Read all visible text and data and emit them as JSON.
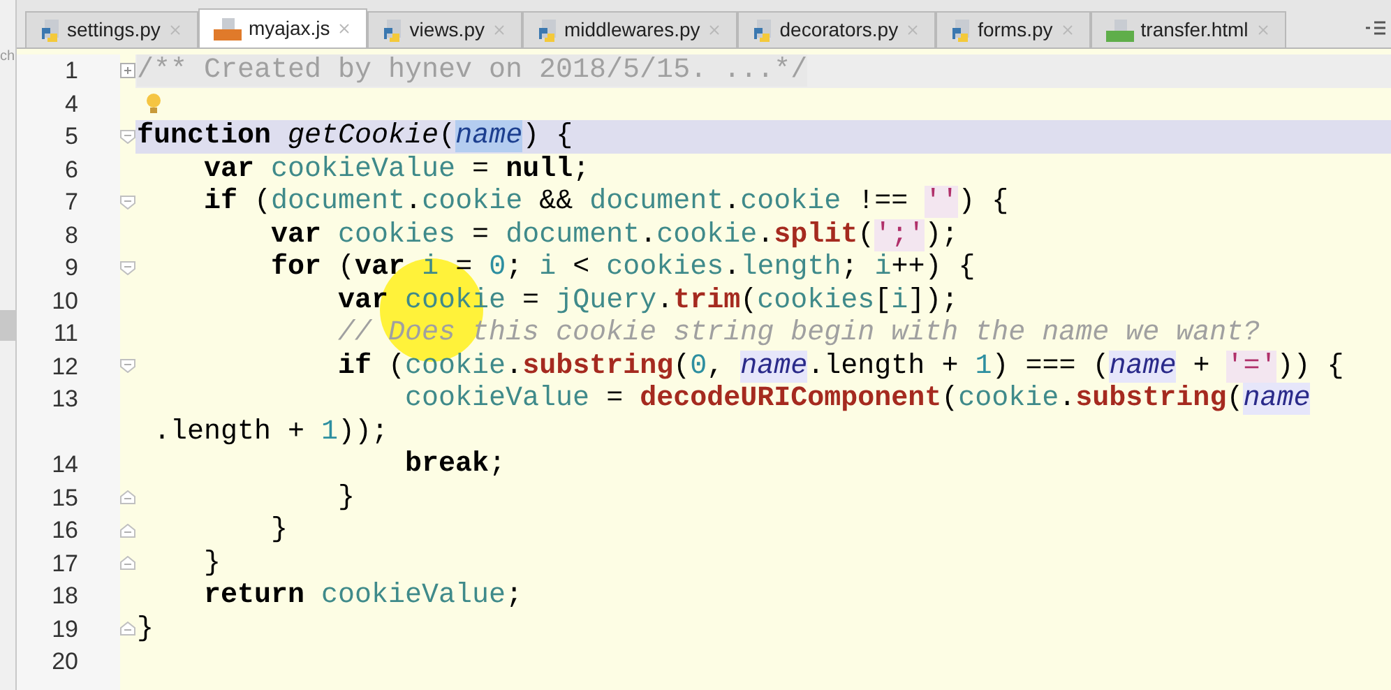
{
  "side_panel": {
    "label": "ch"
  },
  "tabs": [
    {
      "label": "settings.py",
      "kind": "py",
      "selected": false
    },
    {
      "label": "myajax.js",
      "kind": "js",
      "selected": true
    },
    {
      "label": "views.py",
      "kind": "py",
      "selected": false
    },
    {
      "label": "middlewares.py",
      "kind": "py",
      "selected": false
    },
    {
      "label": "decorators.py",
      "kind": "py",
      "selected": false
    },
    {
      "label": "forms.py",
      "kind": "py",
      "selected": false
    },
    {
      "label": "transfer.html",
      "kind": "html",
      "selected": false
    }
  ],
  "editor": {
    "lines": [
      {
        "number": "1",
        "kind": "collapsed",
        "selected": false,
        "tokens": [
          {
            "text": "/** Created by hynev on 2018/5/15. ...*/",
            "kind": "doc"
          }
        ]
      },
      {
        "number": "4",
        "kind": "hint",
        "selected": false
      },
      {
        "number": "5",
        "kind": "start",
        "selected": true,
        "tokens": [
          {
            "text": "function ",
            "kind": "kw"
          },
          {
            "text": "getCookie",
            "kind": "decl"
          },
          {
            "text": "(",
            "kind": "plain"
          },
          {
            "text": "name",
            "kind": "selection"
          },
          {
            "text": ") {",
            "kind": "plain"
          }
        ]
      },
      {
        "number": "6",
        "kind": "plain",
        "selected": false,
        "tokens": [
          {
            "text": "    var ",
            "kind": "kw"
          },
          {
            "text": "cookieValue",
            "kind": "var"
          },
          {
            "text": " = ",
            "kind": "plain"
          },
          {
            "text": "null",
            "kind": "kw"
          },
          {
            "text": ";",
            "kind": "plain"
          }
        ]
      },
      {
        "number": "7",
        "kind": "start",
        "selected": false,
        "tokens": [
          {
            "text": "    if",
            "kind": "kw"
          },
          {
            "text": " (",
            "kind": "plain"
          },
          {
            "text": "document",
            "kind": "var"
          },
          {
            "text": ".",
            "kind": "plain"
          },
          {
            "text": "cookie",
            "kind": "var"
          },
          {
            "text": " && ",
            "kind": "plain"
          },
          {
            "text": "document",
            "kind": "var"
          },
          {
            "text": ".",
            "kind": "plain"
          },
          {
            "text": "cookie",
            "kind": "var"
          },
          {
            "text": " !== ",
            "kind": "plain"
          },
          {
            "text": "''",
            "kind": "str"
          },
          {
            "text": ") {",
            "kind": "plain"
          }
        ]
      },
      {
        "number": "8",
        "kind": "plain",
        "selected": false,
        "tokens": [
          {
            "text": "        var ",
            "kind": "kw"
          },
          {
            "text": "cookies",
            "kind": "var"
          },
          {
            "text": " = ",
            "kind": "plain"
          },
          {
            "text": "document",
            "kind": "var"
          },
          {
            "text": ".",
            "kind": "plain"
          },
          {
            "text": "cookie",
            "kind": "var"
          },
          {
            "text": ".",
            "kind": "plain"
          },
          {
            "text": "split",
            "kind": "fn"
          },
          {
            "text": "(",
            "kind": "plain"
          },
          {
            "text": "';'",
            "kind": "str"
          },
          {
            "text": ");",
            "kind": "plain"
          }
        ]
      },
      {
        "number": "9",
        "kind": "start",
        "selected": false,
        "tokens": [
          {
            "text": "        for",
            "kind": "kw"
          },
          {
            "text": " (",
            "kind": "plain"
          },
          {
            "text": "var ",
            "kind": "kw"
          },
          {
            "text": "i",
            "kind": "var"
          },
          {
            "text": " = ",
            "kind": "plain"
          },
          {
            "text": "0",
            "kind": "num"
          },
          {
            "text": "; ",
            "kind": "plain"
          },
          {
            "text": "i",
            "kind": "var"
          },
          {
            "text": " < ",
            "kind": "plain"
          },
          {
            "text": "cookies",
            "kind": "var"
          },
          {
            "text": ".",
            "kind": "plain"
          },
          {
            "text": "length",
            "kind": "var"
          },
          {
            "text": "; ",
            "kind": "plain"
          },
          {
            "text": "i",
            "kind": "var"
          },
          {
            "text": "++) {",
            "kind": "plain"
          }
        ]
      },
      {
        "number": "10",
        "kind": "plain",
        "selected": false,
        "tokens": [
          {
            "text": "            var ",
            "kind": "kw"
          },
          {
            "text": "cookie",
            "kind": "var"
          },
          {
            "text": " = ",
            "kind": "plain"
          },
          {
            "text": "jQuery",
            "kind": "var"
          },
          {
            "text": ".",
            "kind": "plain"
          },
          {
            "text": "trim",
            "kind": "fn"
          },
          {
            "text": "(",
            "kind": "plain"
          },
          {
            "text": "cookies",
            "kind": "var"
          },
          {
            "text": "[",
            "kind": "plain"
          },
          {
            "text": "i",
            "kind": "var"
          },
          {
            "text": "]);",
            "kind": "plain"
          }
        ]
      },
      {
        "number": "11",
        "kind": "plain",
        "selected": false,
        "tokens": [
          {
            "text": "            // Does this cookie string begin with the name we want?",
            "kind": "comment"
          }
        ]
      },
      {
        "number": "12",
        "kind": "start",
        "selected": false,
        "tokens": [
          {
            "text": "            if",
            "kind": "kw"
          },
          {
            "text": " (",
            "kind": "plain"
          },
          {
            "text": "cookie",
            "kind": "var"
          },
          {
            "text": ".",
            "kind": "plain"
          },
          {
            "text": "substring",
            "kind": "fn"
          },
          {
            "text": "(",
            "kind": "plain"
          },
          {
            "text": "0",
            "kind": "num"
          },
          {
            "text": ", ",
            "kind": "plain"
          },
          {
            "text": "name",
            "kind": "param"
          },
          {
            "text": ".length + ",
            "kind": "plain"
          },
          {
            "text": "1",
            "kind": "num"
          },
          {
            "text": ") === (",
            "kind": "plain"
          },
          {
            "text": "name",
            "kind": "param"
          },
          {
            "text": " + ",
            "kind": "plain"
          },
          {
            "text": "'='",
            "kind": "str"
          },
          {
            "text": ")) {",
            "kind": "plain"
          }
        ]
      },
      {
        "number": "13",
        "kind": "plain",
        "selected": false,
        "tokens": [
          {
            "text": "                cookieValue",
            "kind": "var"
          },
          {
            "text": " = ",
            "kind": "plain"
          },
          {
            "text": "decodeURIComponent",
            "kind": "fn"
          },
          {
            "text": "(",
            "kind": "plain"
          },
          {
            "text": "cookie",
            "kind": "var"
          },
          {
            "text": ".",
            "kind": "plain"
          },
          {
            "text": "substring",
            "kind": "fn"
          },
          {
            "text": "(",
            "kind": "plain"
          },
          {
            "text": "name",
            "kind": "param"
          }
        ]
      },
      {
        "kind": "plain",
        "selected": false,
        "tokens": [
          {
            "text": " .length + ",
            "kind": "plain"
          },
          {
            "text": "1",
            "kind": "num"
          },
          {
            "text": "));",
            "kind": "plain"
          }
        ]
      },
      {
        "number": "14",
        "kind": "plain",
        "selected": false,
        "tokens": [
          {
            "text": "                break",
            "kind": "kw"
          },
          {
            "text": ";",
            "kind": "plain"
          }
        ]
      },
      {
        "number": "15",
        "kind": "end",
        "selected": false,
        "tokens": [
          {
            "text": "            }",
            "kind": "plain"
          }
        ]
      },
      {
        "number": "16",
        "kind": "end",
        "selected": false,
        "tokens": [
          {
            "text": "        }",
            "kind": "plain"
          }
        ]
      },
      {
        "number": "17",
        "kind": "end",
        "selected": false,
        "tokens": [
          {
            "text": "    }",
            "kind": "plain"
          }
        ]
      },
      {
        "number": "18",
        "kind": "plain",
        "selected": false,
        "tokens": [
          {
            "text": "    return ",
            "kind": "kw"
          },
          {
            "text": "cookieValue",
            "kind": "var"
          },
          {
            "text": ";",
            "kind": "plain"
          }
        ]
      },
      {
        "number": "19",
        "kind": "end",
        "selected": false,
        "tokens": [
          {
            "text": "}",
            "kind": "plain"
          }
        ]
      },
      {
        "number": "20",
        "kind": "plain",
        "selected": false
      }
    ]
  }
}
